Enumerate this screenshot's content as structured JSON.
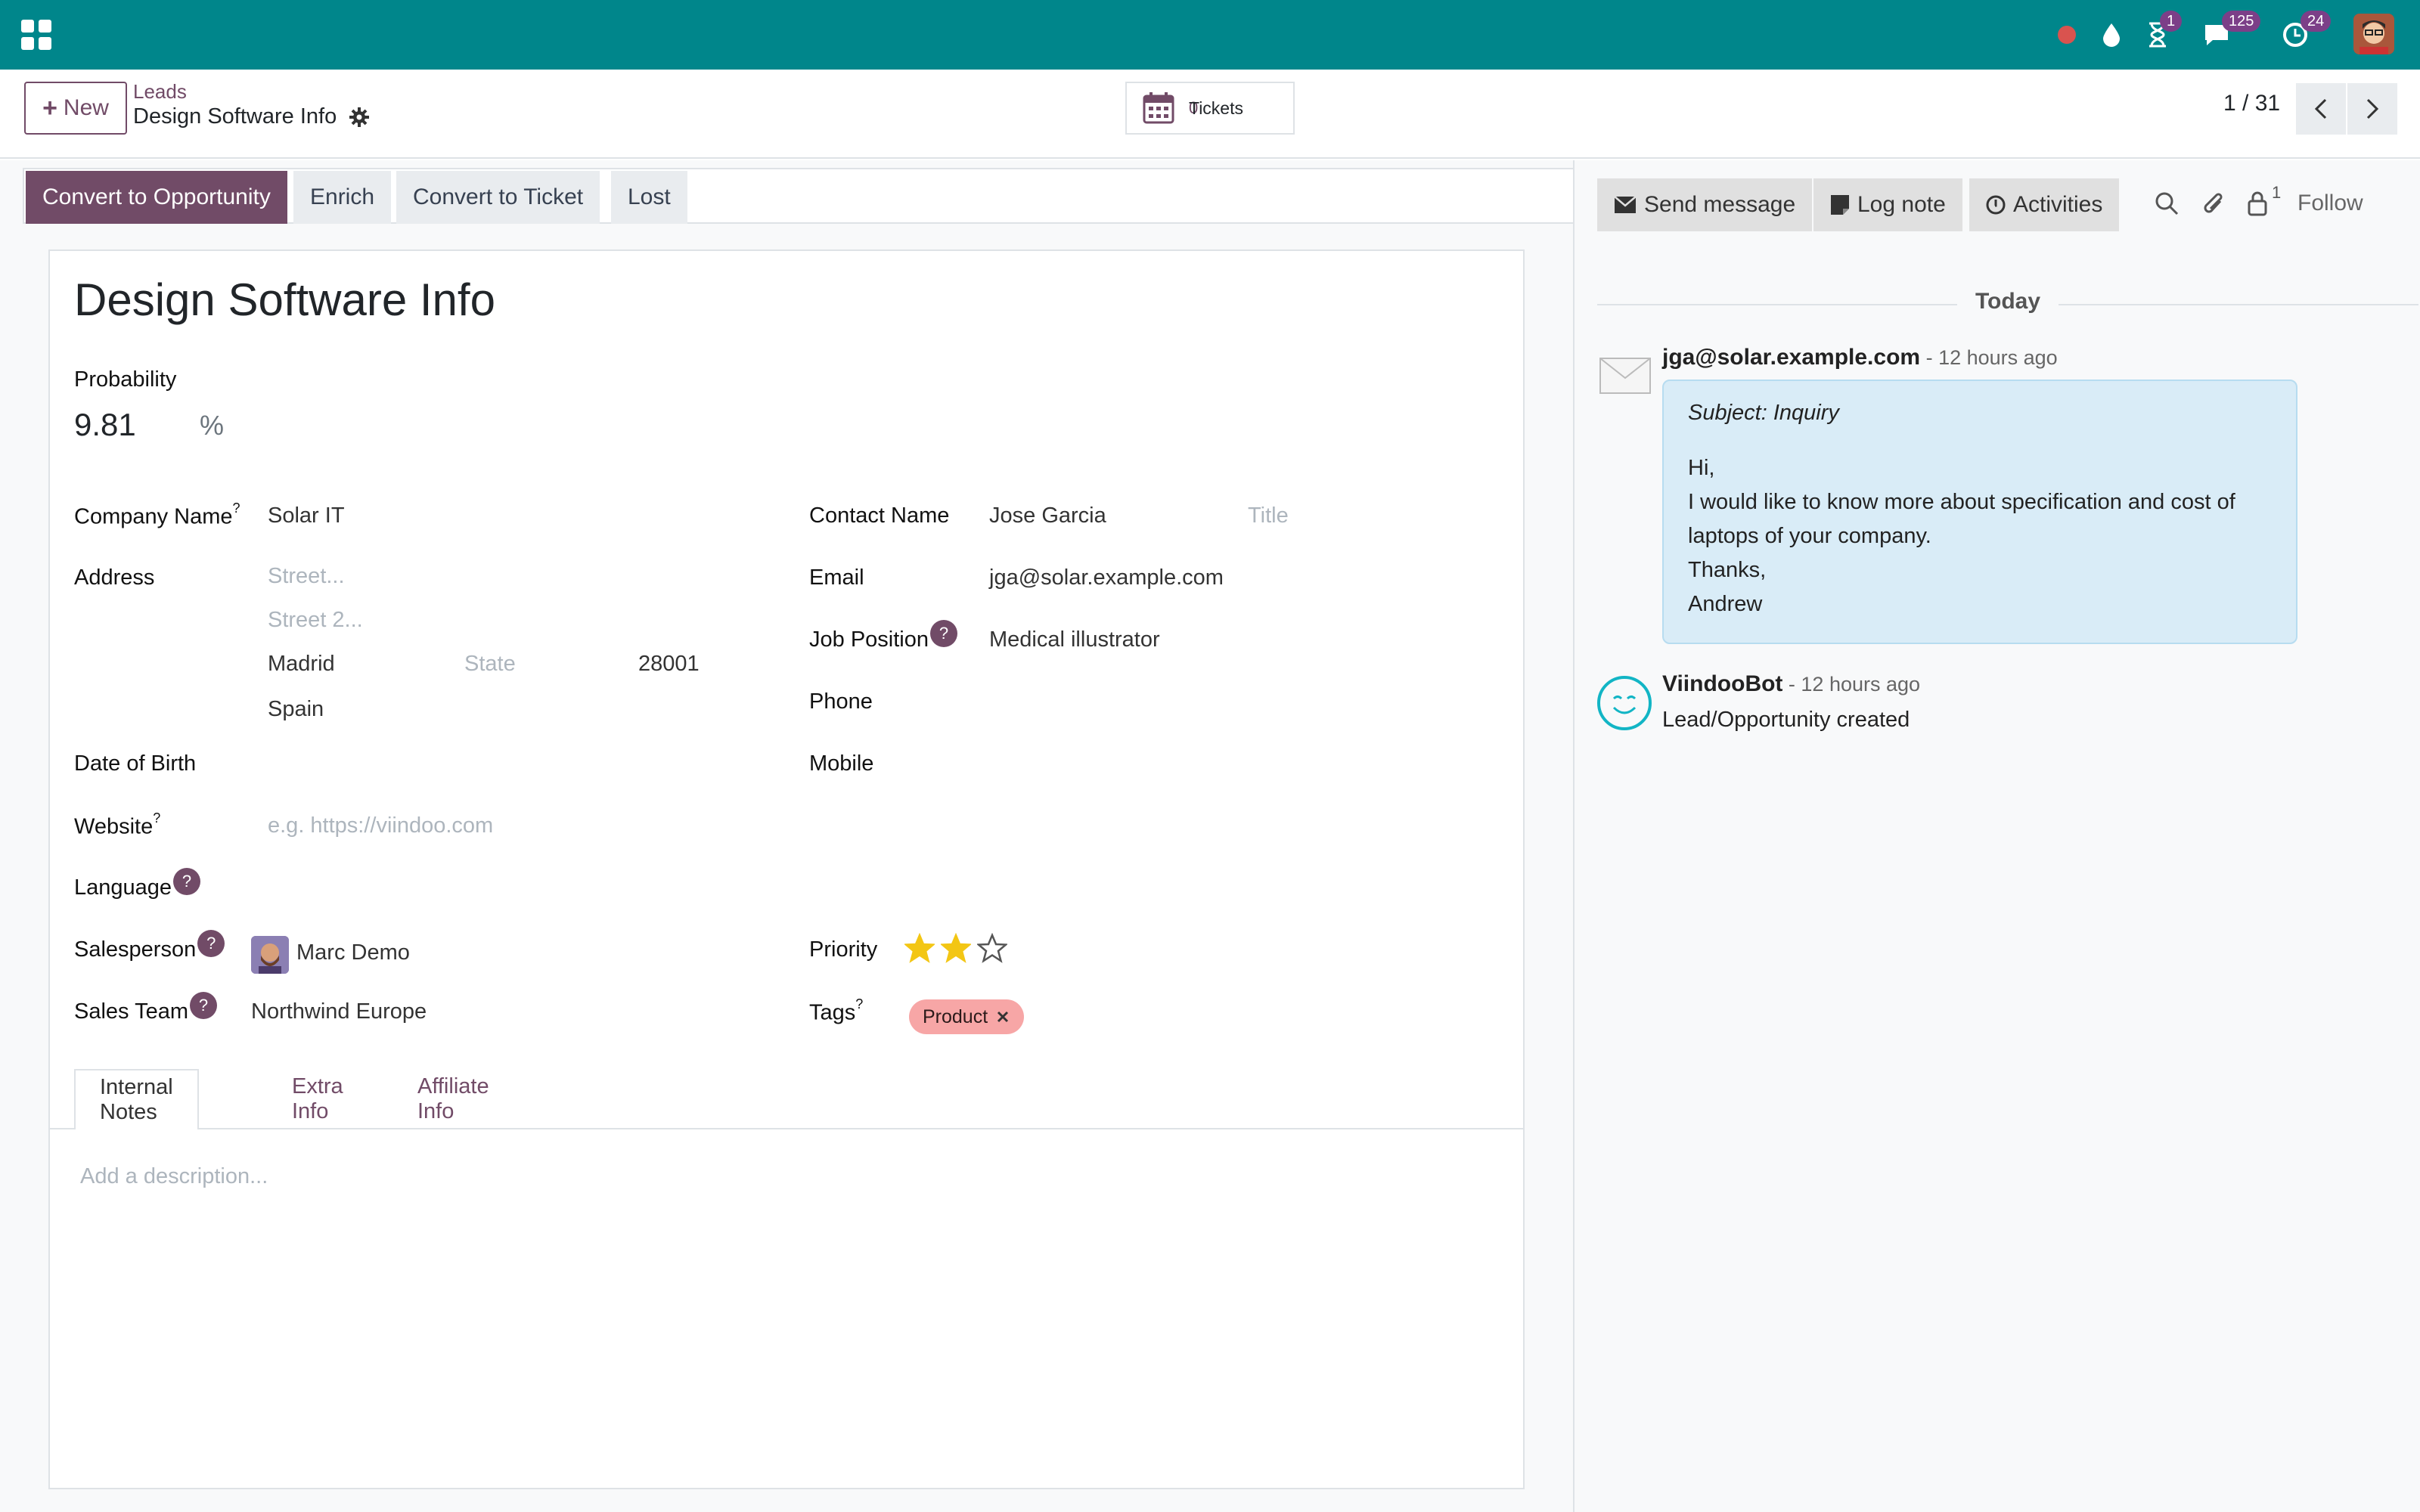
{
  "topbar": {
    "activity_badge": "1",
    "messages_badge": "125",
    "clock_badge": "24"
  },
  "control_panel": {
    "new_label": "New",
    "breadcrumb_parent": "Leads",
    "breadcrumb_current": "Design Software Info",
    "tickets_label": "Tickets",
    "tickets_count": "0",
    "pager": "1 / 31"
  },
  "statusbar": {
    "convert_opportunity": "Convert to Opportunity",
    "enrich": "Enrich",
    "convert_ticket": "Convert to Ticket",
    "lost": "Lost"
  },
  "form": {
    "title": "Design Software Info",
    "probability_label": "Probability",
    "probability_value": "9.81",
    "percent": "%",
    "company_name_label": "Company Name",
    "company_name_value": "Solar IT",
    "address_label": "Address",
    "street_placeholder": "Street...",
    "street2_placeholder": "Street 2...",
    "city": "Madrid",
    "state_placeholder": "State",
    "zip": "28001",
    "country": "Spain",
    "dob_label": "Date of Birth",
    "website_label": "Website",
    "website_placeholder": "e.g. https://viindoo.com",
    "language_label": "Language",
    "salesperson_label": "Salesperson",
    "salesperson_value": "Marc Demo",
    "sales_team_label": "Sales Team",
    "sales_team_value": "Northwind Europe",
    "contact_name_label": "Contact Name",
    "contact_name_value": "Jose Garcia",
    "title_placeholder": "Title",
    "email_label": "Email",
    "email_value": "jga@solar.example.com",
    "job_position_label": "Job Position",
    "job_position_value": "Medical illustrator",
    "phone_label": "Phone",
    "mobile_label": "Mobile",
    "priority_label": "Priority",
    "priority_stars": 2,
    "tags_label": "Tags",
    "tag_value": "Product",
    "tooltip_mark": "?",
    "tabs": [
      "Internal Notes",
      "Extra Info",
      "Affiliate Info"
    ],
    "description_placeholder": "Add a description..."
  },
  "chatter": {
    "send_message": "Send message",
    "log_note": "Log note",
    "activities": "Activities",
    "followers_count": "1",
    "follow": "Follow",
    "today": "Today",
    "msg1_author": "jga@solar.example.com",
    "msg1_time": " - 12 hours ago",
    "msg1_subject": "Subject: Inquiry",
    "msg1_line1": "Hi,",
    "msg1_line2": "I would like to know more about specification and cost of",
    "msg1_line3": "laptops of your company.",
    "msg1_line4": "Thanks,",
    "msg1_line5": "Andrew",
    "msg2_author": "ViindooBot",
    "msg2_time": " - 12 hours ago",
    "msg2_body": "Lead/Opportunity created"
  },
  "colors": {
    "topbar": "#00868b",
    "brand": "#714b67",
    "tag": "#f7a6a6",
    "star": "#f3c614"
  }
}
